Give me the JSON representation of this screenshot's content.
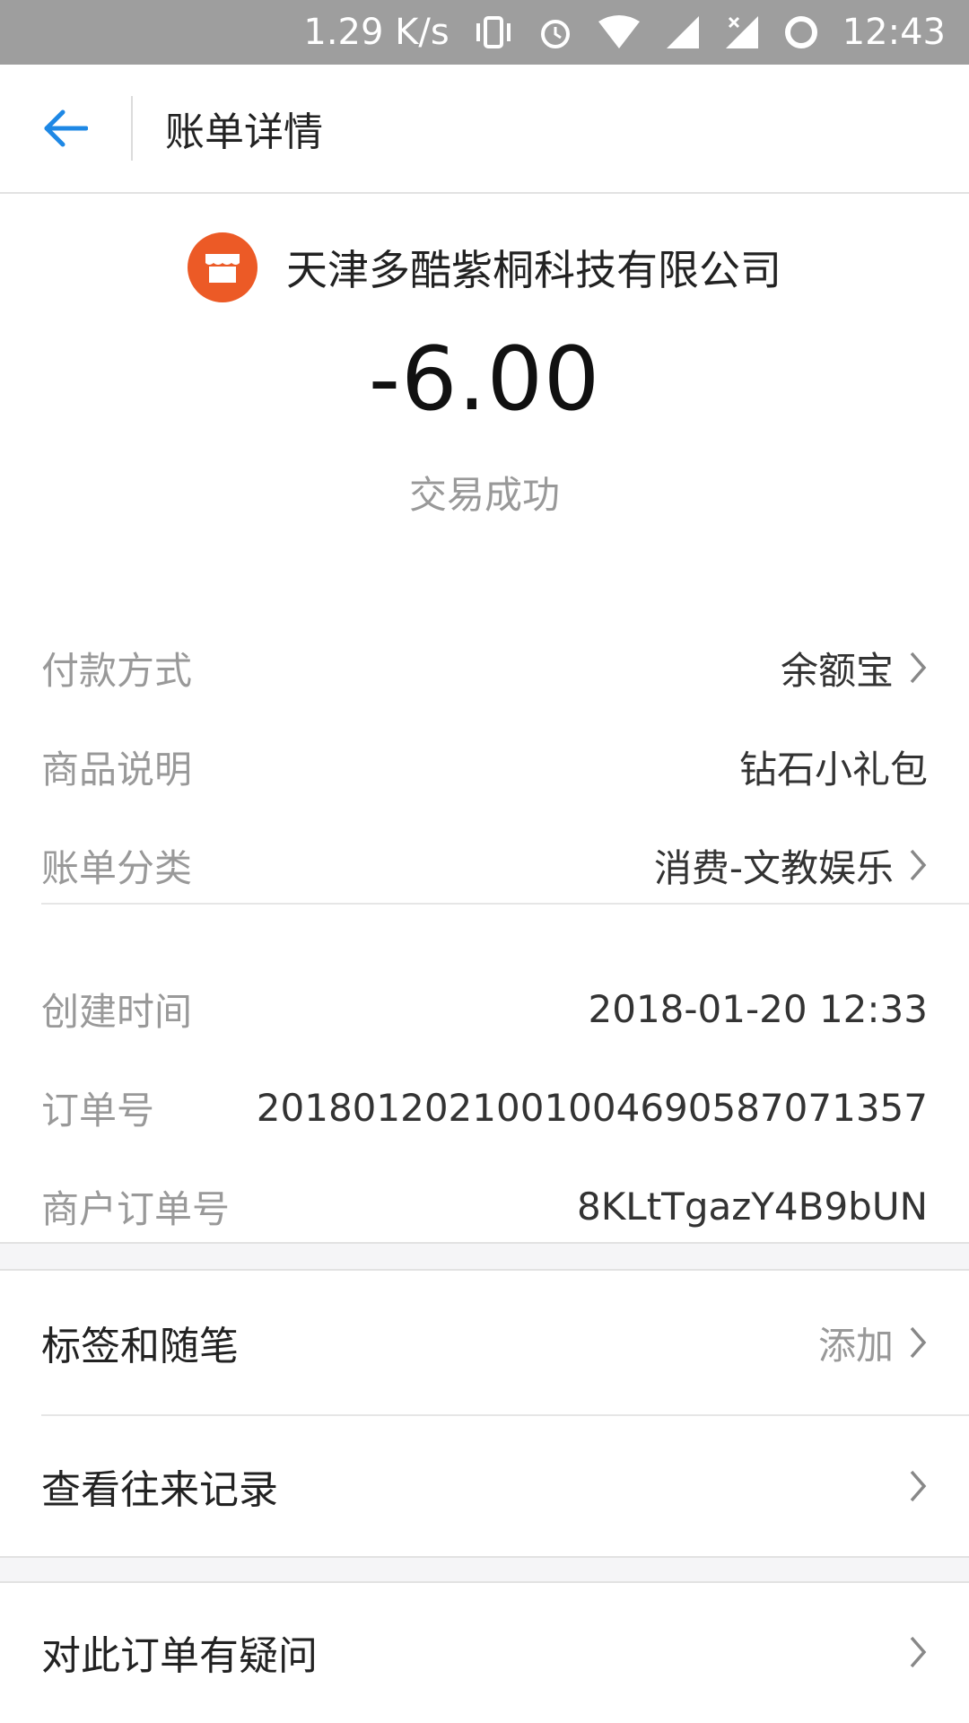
{
  "status_bar": {
    "speed": "1.29 K/s",
    "time": "12:43"
  },
  "header": {
    "title": "账单详情"
  },
  "merchant": {
    "name": "天津多酷紫桐科技有限公司"
  },
  "transaction": {
    "amount": "-6.00",
    "status": "交易成功"
  },
  "details": [
    {
      "label": "付款方式",
      "value": "余额宝"
    },
    {
      "label": "商品说明",
      "value": "钻石小礼包"
    },
    {
      "label": "账单分类",
      "value": "消费-文教娱乐"
    },
    {
      "label": "创建时间",
      "value": "2018-01-20 12:33"
    },
    {
      "label": "订单号",
      "value": "20180120210010046905870713​57"
    },
    {
      "label": "商户订单号",
      "value": "8KLtTgazY4B9bUN"
    }
  ],
  "menu": {
    "tags": {
      "label": "标签和随笔",
      "action": "添加"
    },
    "history": {
      "label": "查看往来记录"
    },
    "question": {
      "label": "对此订单有疑问"
    }
  },
  "colors": {
    "accent": "#1e88e5",
    "merchant_logo": "#ec5a26"
  }
}
